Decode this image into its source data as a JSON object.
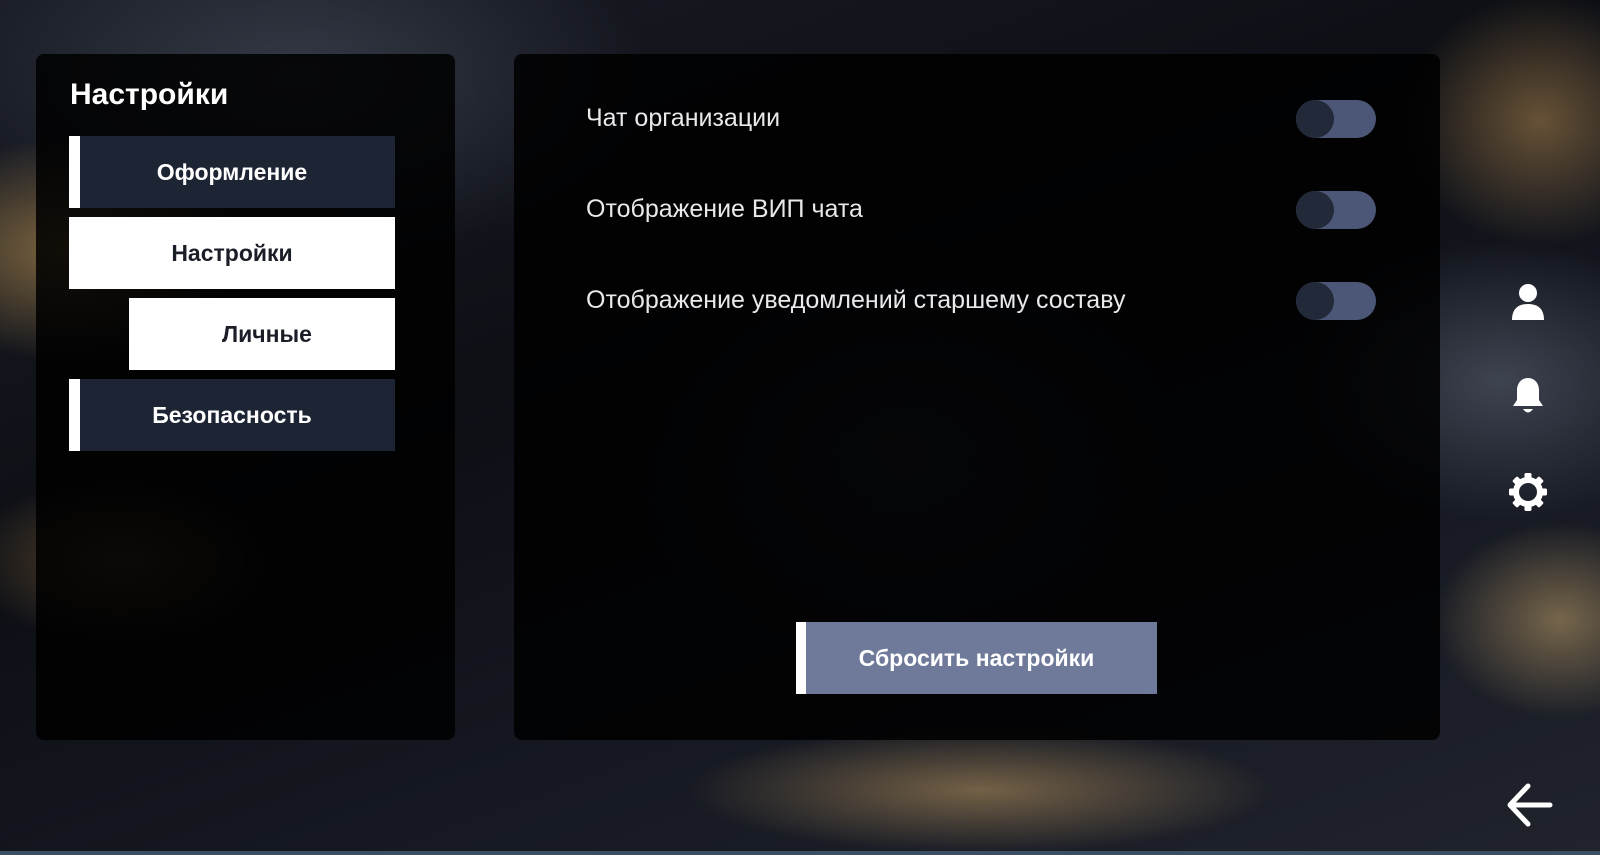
{
  "sidebar": {
    "title": "Настройки",
    "items": [
      {
        "label": "Оформление"
      },
      {
        "label": "Настройки"
      },
      {
        "label": "Личные"
      },
      {
        "label": "Безопасность"
      }
    ]
  },
  "settings": {
    "rows": [
      {
        "label": "Чат организации",
        "enabled": false
      },
      {
        "label": "Отображение ВИП чата",
        "enabled": false
      },
      {
        "label": "Отображение уведомлений старшему составу",
        "enabled": false
      }
    ],
    "reset_label": "Сбросить настройки"
  },
  "right_nav": {
    "icons": [
      "user-icon",
      "bell-icon",
      "gear-icon"
    ],
    "back_icon": "arrow-left-icon"
  },
  "colors": {
    "panel_bg": "#000000",
    "nav_dark": "#1d2433",
    "nav_active": "#ffffff",
    "toggle_track": "#4c5676",
    "toggle_knob": "#222939",
    "button_bg": "#6f7a9b"
  }
}
